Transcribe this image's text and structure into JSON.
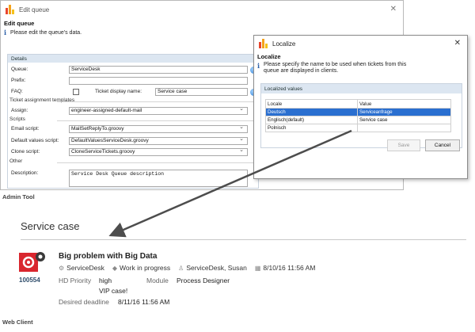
{
  "edit_queue": {
    "window_title": "Edit queue",
    "heading": "Edit queue",
    "info": "Please edit the queue's data.",
    "section_details": "Details",
    "queue_label": "Queue:",
    "queue_value": "ServiceDesk",
    "prefix_label": "Prefix:",
    "prefix_value": "",
    "faq_label": "FAQ:",
    "ticket_display_name_label": "Ticket display name:",
    "ticket_display_name_value": "Service case",
    "section_assignment": "Ticket assignment templates",
    "assign_label": "Assign:",
    "assign_value": "engineer-assigned-default-mail",
    "section_scripts": "Scripts",
    "email_script_label": "Email script:",
    "email_script_value": "MailSetReplyTo.groovy",
    "default_values_script_label": "Default values script:",
    "default_values_script_value": "DefaultValuesServiceDesk.groovy",
    "clone_script_label": "Clone script:",
    "clone_script_value": "CloneServiceTickets.groovy",
    "section_other": "Other",
    "description_label": "Description:",
    "description_value": "Service Desk Queue description"
  },
  "localize": {
    "window_title": "Localize",
    "heading": "Localize",
    "info": "Please specify the name to be used when tickets from this queue are displayed in clients.",
    "panel_title": "Localized values",
    "col_locale": "Locale",
    "col_value": "Value",
    "rows": [
      {
        "locale": "Deutsch",
        "value": "Serviceanfrage"
      },
      {
        "locale": "Englisch(default)",
        "value": "Service case"
      },
      {
        "locale": "Polnisch",
        "value": ""
      }
    ],
    "save_button": "Save",
    "cancel_button": "Cancel"
  },
  "captions": {
    "admin_tool": "Admin Tool",
    "web_client": "Web Client"
  },
  "web_client": {
    "section_title": "Service case",
    "ticket_id": "100554",
    "ticket_title": "Big problem with Big Data",
    "queue": "ServiceDesk",
    "status": "Work in progress",
    "assignee": "ServiceDesk, Susan",
    "date": "8/10/16 11:56 AM",
    "priority_label": "HD Priority",
    "priority_value": "high",
    "module_label": "Module",
    "module_value": "Process Designer",
    "note": "VIP case!",
    "deadline_label": "Desired deadline",
    "deadline_value": "8/11/16 11:56 AM"
  },
  "colors": {
    "selection": "#2a6fd0",
    "panel_header": "#dce6f1",
    "gear_red": "#d9262e",
    "arrow": "#4d4d4d"
  },
  "icons": [
    "app-icon",
    "info-icon",
    "globe-icon",
    "close-icon",
    "gear-icon",
    "queue-icon",
    "status-icon",
    "user-icon",
    "calendar-icon"
  ]
}
